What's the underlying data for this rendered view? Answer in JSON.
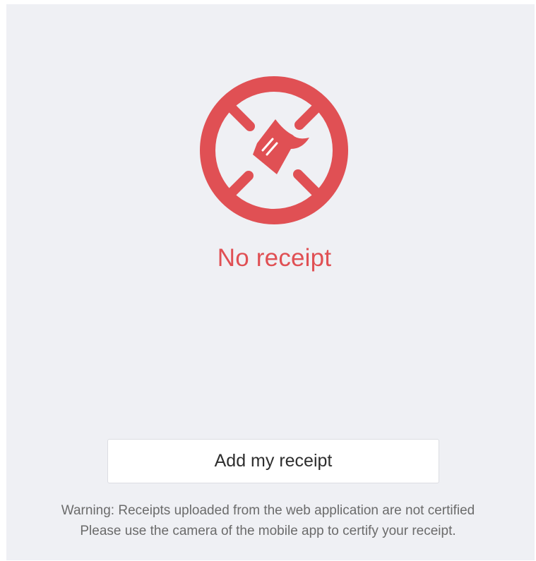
{
  "status": {
    "icon": "no-receipt-icon",
    "title": "No receipt",
    "accent_color": "#e05054"
  },
  "actions": {
    "add_receipt_label": "Add my receipt"
  },
  "warning": {
    "line1": "Warning: Receipts uploaded from the web application are not certified",
    "line2": "Please use the camera of the mobile app to certify your receipt."
  }
}
